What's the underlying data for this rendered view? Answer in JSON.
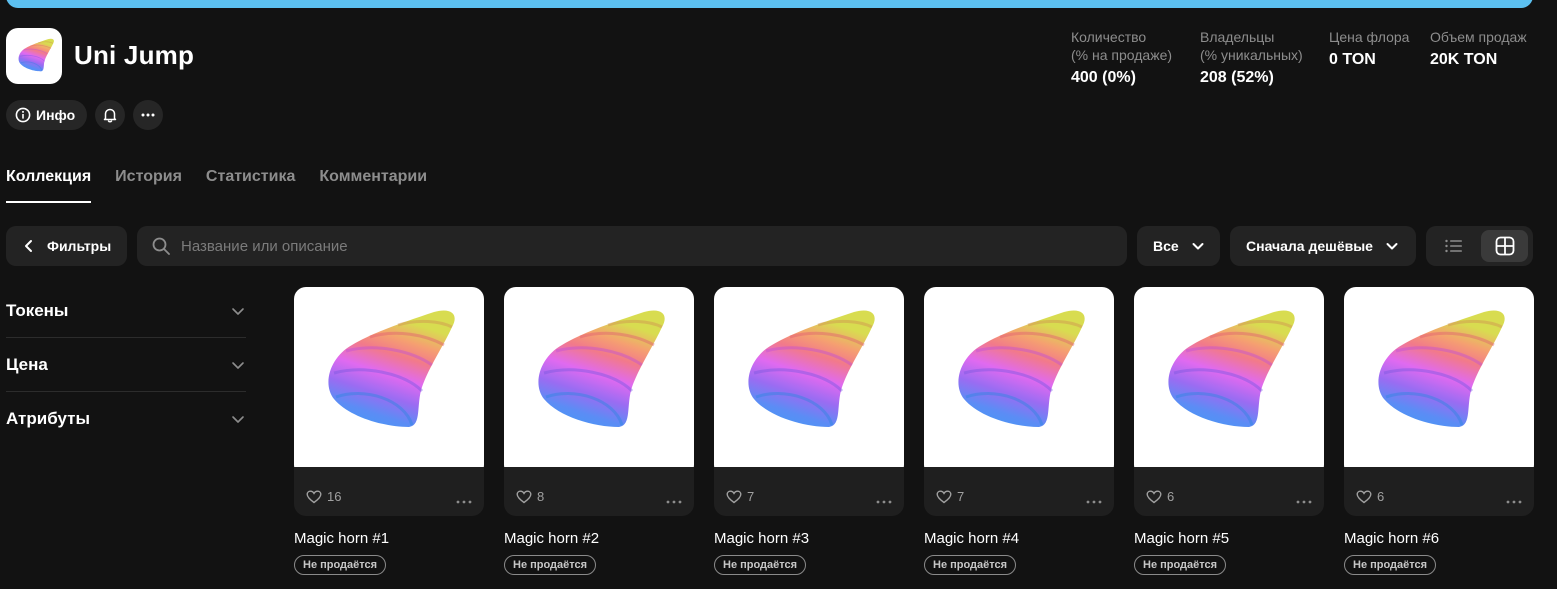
{
  "header": {
    "title": "Uni Jump",
    "logo_icon": "unicorn-horn-icon",
    "info_label": "Инфо"
  },
  "stats": [
    {
      "label_line1": "Количество",
      "label_line2": "(% на продаже)",
      "value": "400 (0%)"
    },
    {
      "label_line1": "Владельцы",
      "label_line2": "(% уникальных)",
      "value": "208 (52%)"
    },
    {
      "label_line1": "Цена флора",
      "label_line2": "",
      "value": "0 TON"
    },
    {
      "label_line1": "Объем продаж",
      "label_line2": "",
      "value": "20K TON"
    }
  ],
  "tabs": [
    {
      "label": "Коллекция",
      "active": true
    },
    {
      "label": "История",
      "active": false
    },
    {
      "label": "Статистика",
      "active": false
    },
    {
      "label": "Комментарии",
      "active": false
    }
  ],
  "toolbar": {
    "filters_label": "Фильтры",
    "search_placeholder": "Название или описание",
    "all_label": "Все",
    "sort_label": "Сначала дешёвые"
  },
  "sidebar": {
    "items": [
      {
        "label": "Токены"
      },
      {
        "label": "Цена"
      },
      {
        "label": "Атрибуты"
      }
    ]
  },
  "cards": [
    {
      "name": "Magic horn #1",
      "likes": "16",
      "badge": "Не продаётся"
    },
    {
      "name": "Magic horn #2",
      "likes": "8",
      "badge": "Не продаётся"
    },
    {
      "name": "Magic horn #3",
      "likes": "7",
      "badge": "Не продаётся"
    },
    {
      "name": "Magic horn #4",
      "likes": "7",
      "badge": "Не продаётся"
    },
    {
      "name": "Magic horn #5",
      "likes": "6",
      "badge": "Не продаётся"
    },
    {
      "name": "Magic horn #6",
      "likes": "6",
      "badge": "Не продаётся"
    }
  ],
  "colors": {
    "background": "#121212",
    "surface": "#232323",
    "banner": "#5cc0f0",
    "muted_text": "#8d8d8d"
  }
}
